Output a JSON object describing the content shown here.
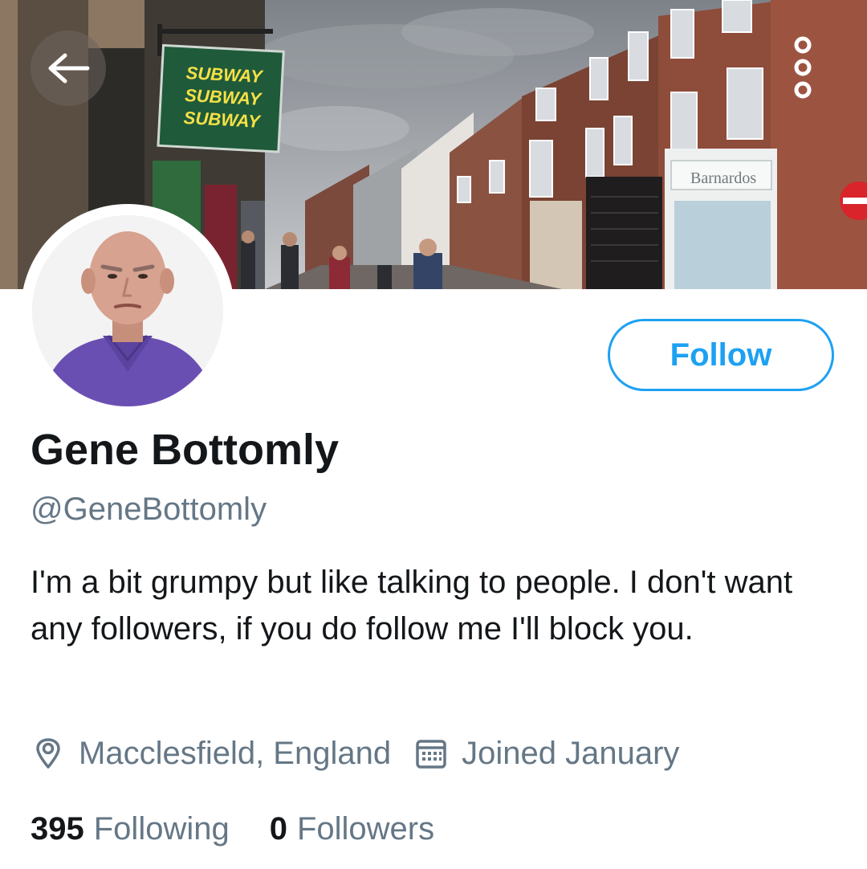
{
  "header": {
    "back_icon": "arrow-left-icon",
    "more_icon": "more-vertical-icon",
    "banner_signs": {
      "subway_lines": [
        "SUBWAY",
        "SUBWAY",
        "SUBWAY"
      ],
      "barnardos": "Barnardos"
    }
  },
  "profile": {
    "display_name": "Gene Bottomly",
    "handle": "@GeneBottomly",
    "bio": "I'm a bit grumpy but like talking to people. I don't want any followers, if you do follow me I'll block you.",
    "location": "Macclesfield, England",
    "location_icon": "location-pin-icon",
    "joined": "Joined January",
    "joined_icon": "calendar-icon"
  },
  "actions": {
    "follow_label": "Follow"
  },
  "stats": {
    "following_count": "395",
    "following_label": "Following",
    "followers_count": "0",
    "followers_label": "Followers"
  },
  "colors": {
    "accent": "#1da1f2",
    "secondary_text": "#657786",
    "primary_text": "#14171a"
  }
}
